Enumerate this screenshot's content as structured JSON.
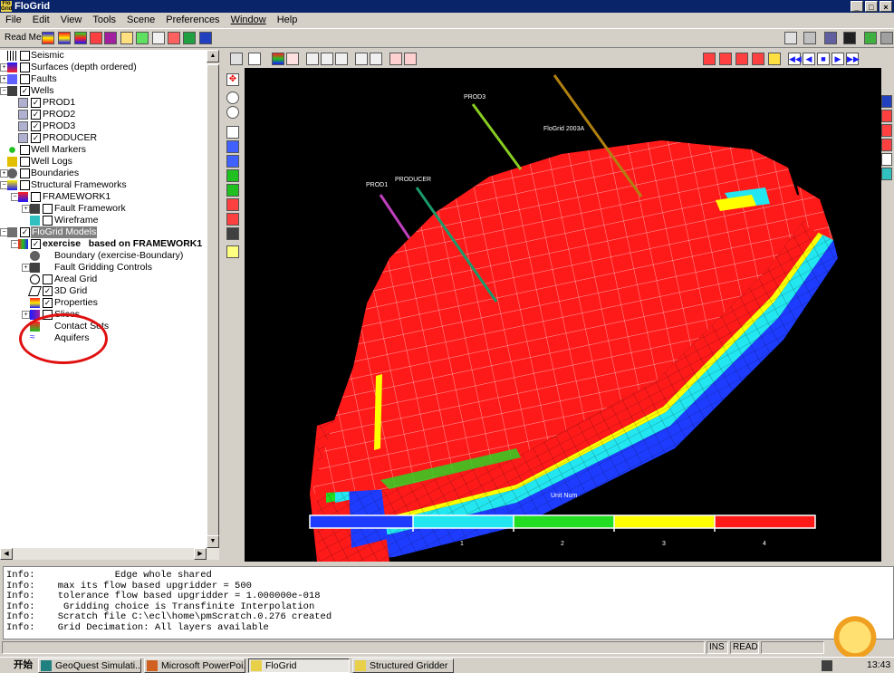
{
  "window": {
    "title": "FloGrid",
    "app_icon_text": "Flo Grid"
  },
  "menu": [
    "File",
    "Edit",
    "View",
    "Tools",
    "Scene",
    "Preferences",
    "Window",
    "Help"
  ],
  "toolbar": {
    "read_me": "Read Me"
  },
  "tree": [
    {
      "label": "Seismic",
      "checked": false
    },
    {
      "label": "Surfaces (depth ordered)",
      "checked": false
    },
    {
      "label": "Faults",
      "checked": false
    },
    {
      "label": "Wells",
      "checked": true
    },
    {
      "label": "PROD1",
      "checked": true
    },
    {
      "label": "PROD2",
      "checked": true
    },
    {
      "label": "PROD3",
      "checked": true
    },
    {
      "label": "PRODUCER",
      "checked": true
    },
    {
      "label": "Well Markers",
      "checked": false
    },
    {
      "label": "Well Logs",
      "checked": false
    },
    {
      "label": "Boundaries",
      "checked": false
    },
    {
      "label": "Structural Frameworks",
      "checked": false
    },
    {
      "label": "FRAMEWORK1",
      "checked": false
    },
    {
      "label": "Fault Framework",
      "checked": false
    },
    {
      "label": "Wireframe",
      "checked": false
    },
    {
      "label": "FloGrid Models",
      "checked": true,
      "selected": true
    },
    {
      "label": "exercise   based on FRAMEWORK1",
      "checked": true,
      "bold": true
    },
    {
      "label": "Boundary (exercise-Boundary)"
    },
    {
      "label": "Fault Gridding Controls"
    },
    {
      "label": "Areal Grid",
      "checked": false
    },
    {
      "label": "3D Grid",
      "checked": true
    },
    {
      "label": "Properties",
      "checked": true
    },
    {
      "label": "Slices",
      "checked": false
    },
    {
      "label": "Contact Sets"
    },
    {
      "label": "Aquifers"
    }
  ],
  "scene": {
    "watermark": "FloGrid 2003A",
    "wells": [
      "PROD1",
      "PRODUCER",
      "PROD3"
    ],
    "legend_title": "Unit Num",
    "legend_ticks": [
      "1",
      "2",
      "3",
      "4"
    ],
    "colors": {
      "unit1": "#1e3cff",
      "unit2": "#22e6f0",
      "unit3": "#22dd22",
      "unit4": "#ffff00",
      "unit5": "#ff1a1a"
    }
  },
  "console": [
    "Info:              Edge whole shared",
    "Info:    max its flow based upgridder = 500",
    "Info:    tolerance flow based upgridder = 1.000000e-018",
    "Info:     Gridding choice is Transfinite Interpolation",
    "Info:    Scratch file C:\\ecl\\home\\pmScratch.0.276 created",
    "Info:    Grid Decimation: All layers available"
  ],
  "status": {
    "ins": "INS",
    "read": "READ"
  },
  "taskbar": {
    "start": "开始",
    "items": [
      "GeoQuest Simulati...",
      "Microsoft PowerPoi...",
      "FloGrid",
      "Structured Gridder"
    ],
    "clock": "13:43"
  }
}
